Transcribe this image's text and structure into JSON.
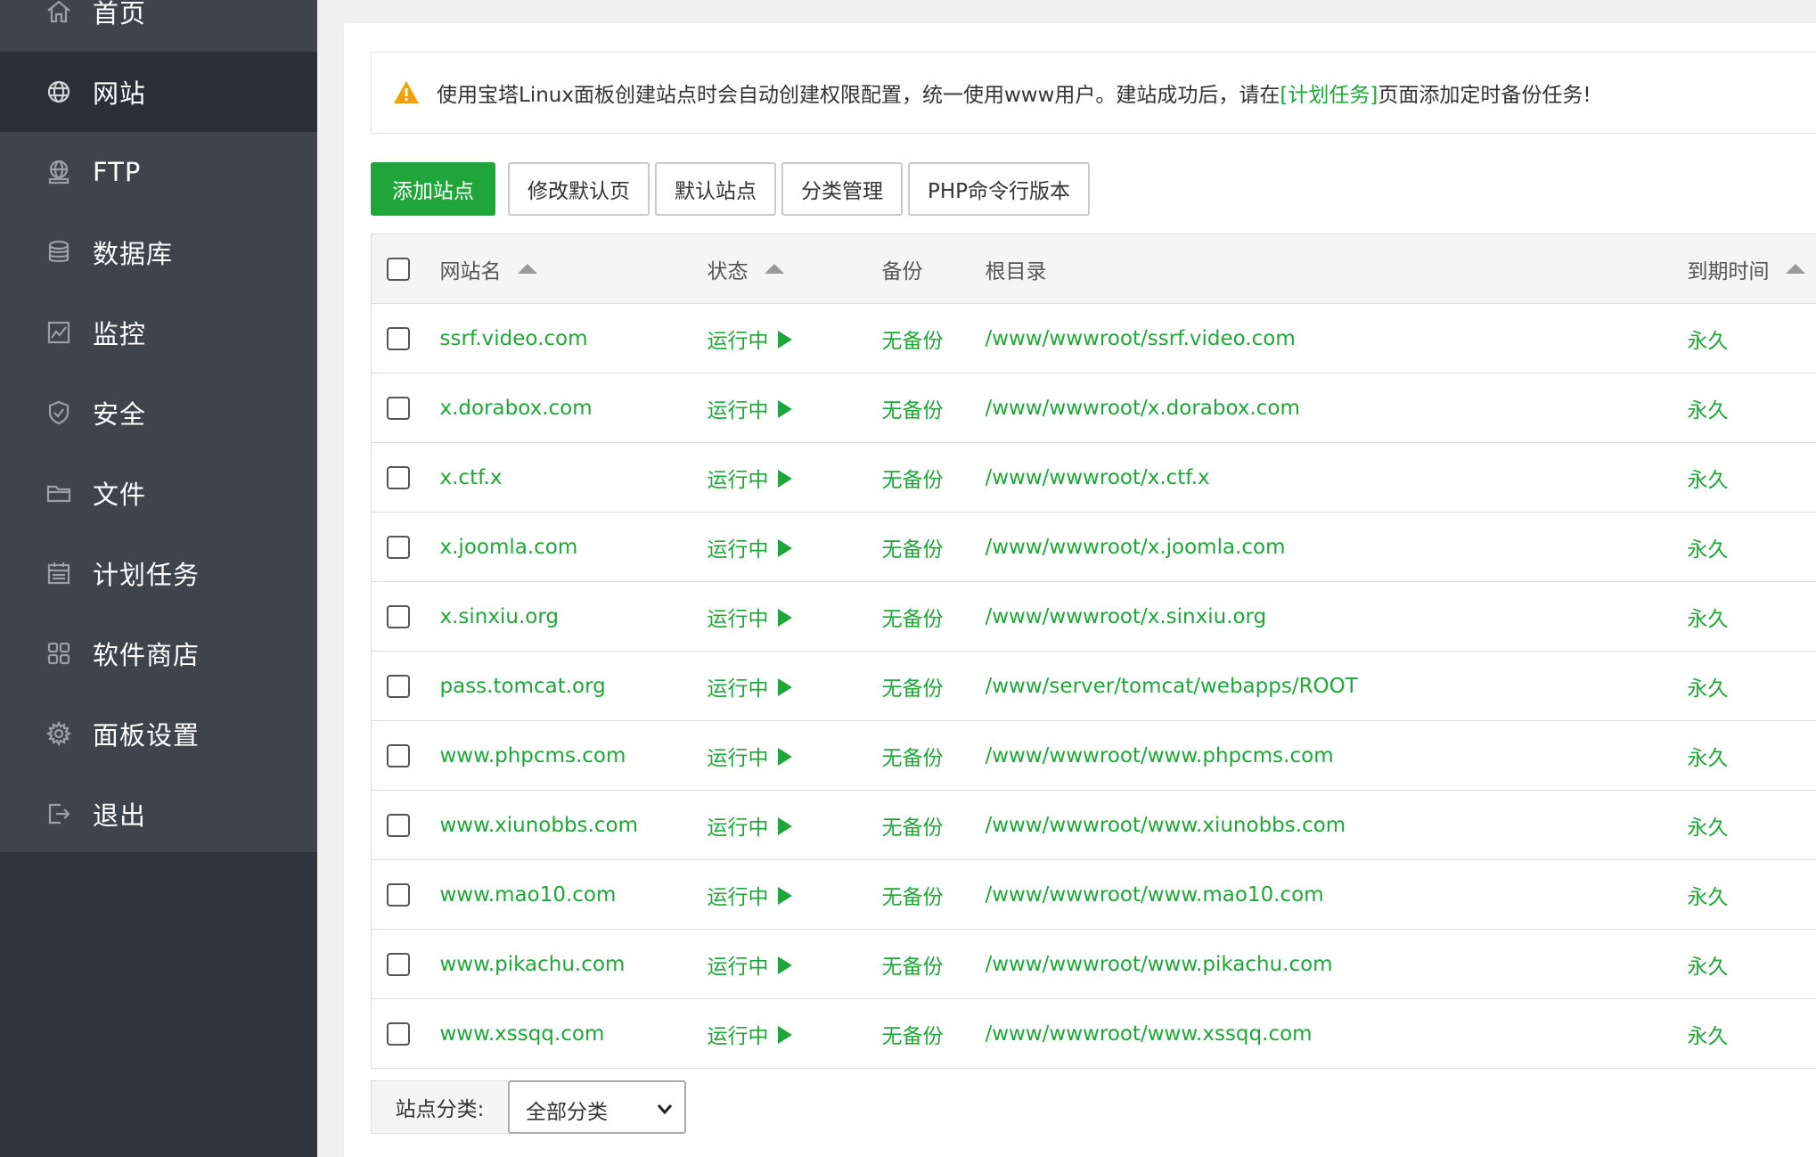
{
  "sidebar": {
    "items": [
      {
        "label": "首页",
        "icon": "home-icon"
      },
      {
        "label": "网站",
        "icon": "globe-icon",
        "active": true
      },
      {
        "label": "FTP",
        "icon": "ftp-icon"
      },
      {
        "label": "数据库",
        "icon": "database-icon"
      },
      {
        "label": "监控",
        "icon": "monitor-icon"
      },
      {
        "label": "安全",
        "icon": "shield-icon"
      },
      {
        "label": "文件",
        "icon": "folder-icon"
      },
      {
        "label": "计划任务",
        "icon": "calendar-icon"
      },
      {
        "label": "软件商店",
        "icon": "grid-icon"
      },
      {
        "label": "面板设置",
        "icon": "gear-icon"
      },
      {
        "label": "退出",
        "icon": "logout-icon"
      }
    ]
  },
  "notice": {
    "icon": "warning-icon",
    "text_before": "使用宝塔Linux面板创建站点时会自动创建权限配置，统一使用www用户。建站成功后，请在",
    "link": "[计划任务]",
    "text_after": "页面添加定时备份任务!"
  },
  "toolbar": {
    "add_site": "添加站点",
    "modify_default_page": "修改默认页",
    "default_site": "默认站点",
    "category_manage": "分类管理",
    "php_cli_version": "PHP命令行版本"
  },
  "table": {
    "headers": {
      "name": "网站名",
      "status": "状态",
      "backup": "备份",
      "root": "根目录",
      "expire": "到期时间"
    },
    "rows": [
      {
        "name": "ssrf.video.com",
        "status": "运行中",
        "backup": "无备份",
        "root": "/www/wwwroot/ssrf.video.com",
        "expire": "永久"
      },
      {
        "name": "x.dorabox.com",
        "status": "运行中",
        "backup": "无备份",
        "root": "/www/wwwroot/x.dorabox.com",
        "expire": "永久"
      },
      {
        "name": "x.ctf.x",
        "status": "运行中",
        "backup": "无备份",
        "root": "/www/wwwroot/x.ctf.x",
        "expire": "永久"
      },
      {
        "name": "x.joomla.com",
        "status": "运行中",
        "backup": "无备份",
        "root": "/www/wwwroot/x.joomla.com",
        "expire": "永久"
      },
      {
        "name": "x.sinxiu.org",
        "status": "运行中",
        "backup": "无备份",
        "root": "/www/wwwroot/x.sinxiu.org",
        "expire": "永久"
      },
      {
        "name": "pass.tomcat.org",
        "status": "运行中",
        "backup": "无备份",
        "root": "/www/server/tomcat/webapps/ROOT",
        "expire": "永久"
      },
      {
        "name": "www.phpcms.com",
        "status": "运行中",
        "backup": "无备份",
        "root": "/www/wwwroot/www.phpcms.com",
        "expire": "永久"
      },
      {
        "name": "www.xiunobbs.com",
        "status": "运行中",
        "backup": "无备份",
        "root": "/www/wwwroot/www.xiunobbs.com",
        "expire": "永久"
      },
      {
        "name": "www.mao10.com",
        "status": "运行中",
        "backup": "无备份",
        "root": "/www/wwwroot/www.mao10.com",
        "expire": "永久"
      },
      {
        "name": "www.pikachu.com",
        "status": "运行中",
        "backup": "无备份",
        "root": "/www/wwwroot/www.pikachu.com",
        "expire": "永久"
      },
      {
        "name": "www.xssqq.com",
        "status": "运行中",
        "backup": "无备份",
        "root": "/www/wwwroot/www.xssqq.com",
        "expire": "永久"
      }
    ]
  },
  "filter": {
    "label": "站点分类:",
    "selected": "全部分类"
  },
  "colors": {
    "accent": "#20a53a",
    "sidebar_bg": "#3e444c",
    "sidebar_active": "#2b3038",
    "warning": "#f0a000"
  }
}
